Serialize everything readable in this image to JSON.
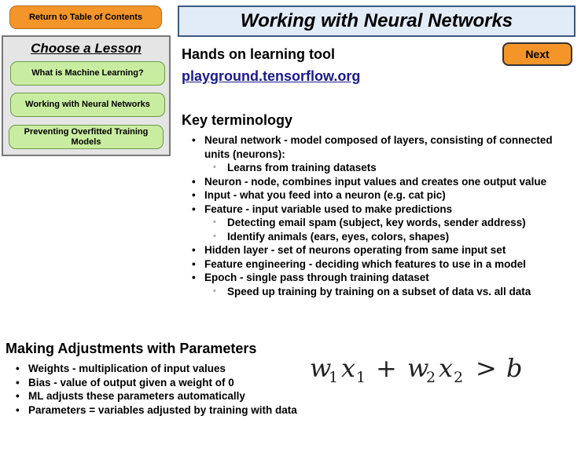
{
  "nav": {
    "toc_label": "Return to Table of Contents",
    "next_label": "Next"
  },
  "title": "Working with Neural Networks",
  "lessons": {
    "heading": "Choose a Lesson",
    "items": [
      "What is Machine Learning?",
      "Working with Neural Networks",
      "Preventing Overfitted Training Models"
    ]
  },
  "tool": {
    "heading": "Hands on learning tool",
    "link": "playground.tensorflow.org"
  },
  "terminology": {
    "heading": "Key terminology",
    "items": [
      "Neural network - model composed of layers, consisting of connected units (neurons):",
      "Learns from training datasets",
      "Neuron - node, combines input values and creates one output value",
      "Input - what you feed into a neuron (e.g. cat pic)",
      "Feature - input variable used to make predictions",
      "Detecting email spam (subject, key words, sender address)",
      "Identify animals (ears, eyes, colors, shapes)",
      "Hidden layer - set of neurons operating from same input set",
      "Feature engineering - deciding which features to use in a model",
      "Epoch - single pass through training dataset",
      "Speed up training by training on a subset of data vs. all data"
    ]
  },
  "parameters": {
    "heading": "Making Adjustments with Parameters",
    "items": [
      "Weights - multiplication of input values",
      "Bias - value of output given a weight of 0",
      "ML adjusts these parameters automatically",
      "Parameters = variables adjusted by training with data"
    ]
  },
  "formula": {
    "w": "w",
    "x": "x",
    "sub1": "1",
    "sub2": "2",
    "plus": "+",
    "gt": ">",
    "b": "b"
  }
}
